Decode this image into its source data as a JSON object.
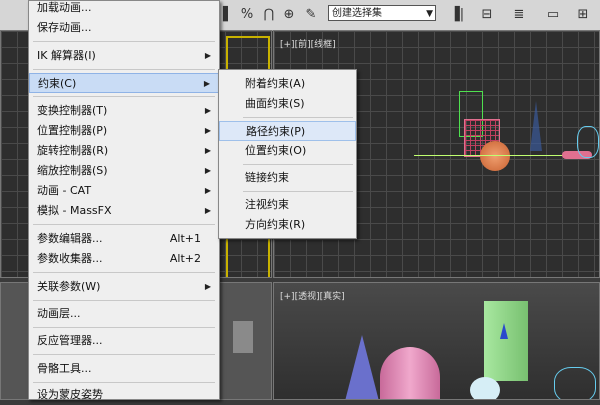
{
  "toolbar": {
    "selection_set_value": "创建选择集"
  },
  "viewports": {
    "top_right_label": "[+][前][线框]",
    "bottom_right_label": "[+][透视][真实]"
  },
  "menu": {
    "items": [
      {
        "label": "加载动画..."
      },
      {
        "label": "保存动画..."
      },
      {
        "label": "IK 解算器(I)"
      },
      {
        "label": "约束(C)"
      },
      {
        "label": "变换控制器(T)"
      },
      {
        "label": "位置控制器(P)"
      },
      {
        "label": "旋转控制器(R)"
      },
      {
        "label": "缩放控制器(S)"
      },
      {
        "label": "动画 - CAT"
      },
      {
        "label": "模拟 - MassFX"
      },
      {
        "label": "参数编辑器...",
        "shortcut": "Alt+1"
      },
      {
        "label": "参数收集器...",
        "shortcut": "Alt+2"
      },
      {
        "label": "关联参数(W)"
      },
      {
        "label": "动画层..."
      },
      {
        "label": "反应管理器..."
      },
      {
        "label": "骨骼工具..."
      },
      {
        "label": "设为蒙皮姿势"
      }
    ]
  },
  "submenu": {
    "items": [
      {
        "label": "附着约束(A)"
      },
      {
        "label": "曲面约束(S)"
      },
      {
        "label": "路径约束(P)"
      },
      {
        "label": "位置约束(O)"
      },
      {
        "label": "链接约束"
      },
      {
        "label": "注视约束"
      },
      {
        "label": "方向约束(R)"
      }
    ]
  }
}
